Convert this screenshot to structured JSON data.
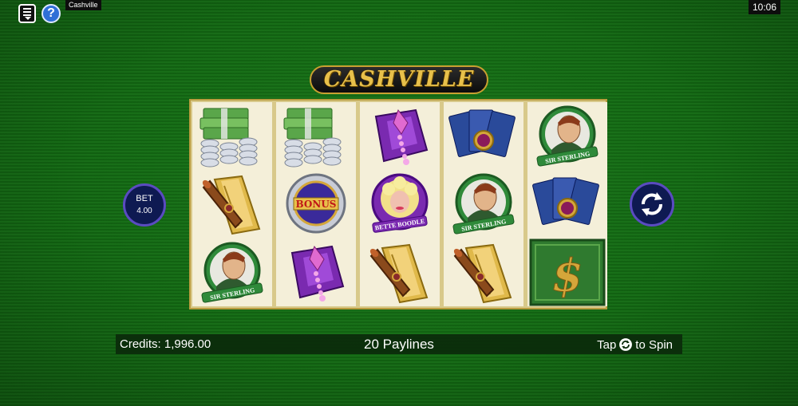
{
  "top_bar": {
    "menu_icon": "menu-icon",
    "help_icon": "help-icon",
    "help_glyph": "?",
    "game_name": "Cashville",
    "clock": "10:06"
  },
  "logo": {
    "text": "CASHVILLE"
  },
  "reels": [
    [
      "cash-stack",
      "cigar",
      "sir-sterling"
    ],
    [
      "cash-stack",
      "bonus",
      "jewels"
    ],
    [
      "jewels",
      "bette-boodle",
      "cigar"
    ],
    [
      "cards",
      "sir-sterling",
      "cigar"
    ],
    [
      "sir-sterling",
      "cards",
      "dollar-s"
    ]
  ],
  "symbol_labels": {
    "bonus": "BONUS",
    "sir_sterling": "SIR STERLING",
    "bette_boodle": "BETTE BOODLE"
  },
  "bet": {
    "label": "BET",
    "value": "4.00"
  },
  "spin_icon": "spin-icon",
  "status": {
    "credits": "Credits: 1,996.00",
    "paylines": "20 Paylines",
    "tap_label": "Tap",
    "to_spin_label": "to Spin"
  },
  "colors": {
    "felt": "#136b13",
    "gold": "#c9a030",
    "button_bg": "#0e1a52"
  }
}
